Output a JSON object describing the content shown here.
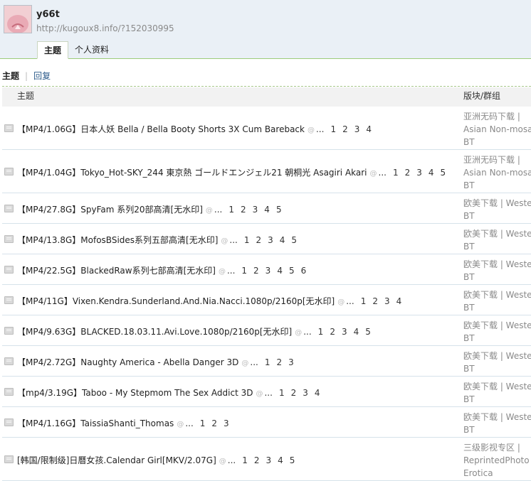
{
  "user": {
    "name": "y66t",
    "url": "http://kugoux8.info/?152030995"
  },
  "tabs": [
    {
      "label": "主题",
      "active": true
    },
    {
      "label": "个人资料",
      "active": false
    }
  ],
  "subnav": {
    "current": "主题",
    "link": "回复"
  },
  "table": {
    "headers": {
      "subject": "主题",
      "forum": "版块/群组"
    },
    "rows": [
      {
        "title": "【MP4/1.06G】日本人妖 Bella / Bella Booty Shorts 3X Cum Bareback",
        "pages": [
          "1",
          "2",
          "3",
          "4"
        ],
        "forum_lines": [
          "亚洲无码下载 |",
          "Asian Non-mosaic",
          "BT"
        ]
      },
      {
        "title": "【MP4/1.04G】Tokyo_Hot-SKY_244 東京熱 ゴールドエンジェル21 朝桐光 Asagiri Akari",
        "pages": [
          "1",
          "2",
          "3",
          "4",
          "5"
        ],
        "forum_lines": [
          "亚洲无码下载 |",
          "Asian Non-mosaic",
          "BT"
        ]
      },
      {
        "title": "【MP4/27.8G】SpyFam 系列20部高清[无水印]",
        "pages": [
          "1",
          "2",
          "3",
          "4",
          "5"
        ],
        "forum_lines": [
          "欧美下载 | Western",
          "BT"
        ]
      },
      {
        "title": "【MP4/13.8G】MofosBSides系列五部高清[无水印]",
        "pages": [
          "1",
          "2",
          "3",
          "4",
          "5"
        ],
        "forum_lines": [
          "欧美下载 | Western",
          "BT"
        ]
      },
      {
        "title": "【MP4/22.5G】BlackedRaw系列七部高清[无水印]",
        "pages": [
          "1",
          "2",
          "3",
          "4",
          "5",
          "6"
        ],
        "forum_lines": [
          "欧美下载 | Western",
          "BT"
        ]
      },
      {
        "title": "【MP4/11G】Vixen.Kendra.Sunderland.And.Nia.Nacci.1080p/2160p[无水印]",
        "pages": [
          "1",
          "2",
          "3",
          "4"
        ],
        "forum_lines": [
          "欧美下载 | Western",
          "BT"
        ]
      },
      {
        "title": "【MP4/9.63G】BLACKED.18.03.11.Avi.Love.1080p/2160p[无水印]",
        "pages": [
          "1",
          "2",
          "3",
          "4",
          "5"
        ],
        "forum_lines": [
          "欧美下载 | Western",
          "BT"
        ]
      },
      {
        "title": "【MP4/2.72G】Naughty America - Abella Danger 3D",
        "pages": [
          "1",
          "2",
          "3"
        ],
        "forum_lines": [
          "欧美下载 | Western",
          "BT"
        ]
      },
      {
        "title": "【mp4/3.19G】Taboo - My Stepmom The Sex Addict 3D",
        "pages": [
          "1",
          "2",
          "3",
          "4"
        ],
        "forum_lines": [
          "欧美下载 | Western",
          "BT"
        ]
      },
      {
        "title": "【MP4/1.16G】TaissiaShanti_Thomas",
        "pages": [
          "1",
          "2",
          "3"
        ],
        "forum_lines": [
          "欧美下载 | Western",
          "BT"
        ]
      },
      {
        "title": "[韩国/限制级]日曆女孩.Calendar Girl[MKV/2.07G]",
        "pages": [
          "1",
          "2",
          "3",
          "4",
          "5"
        ],
        "forum_lines": [
          "三级影视专区 |",
          "ReprintedPhoto and",
          "Erotica"
        ]
      }
    ]
  }
}
